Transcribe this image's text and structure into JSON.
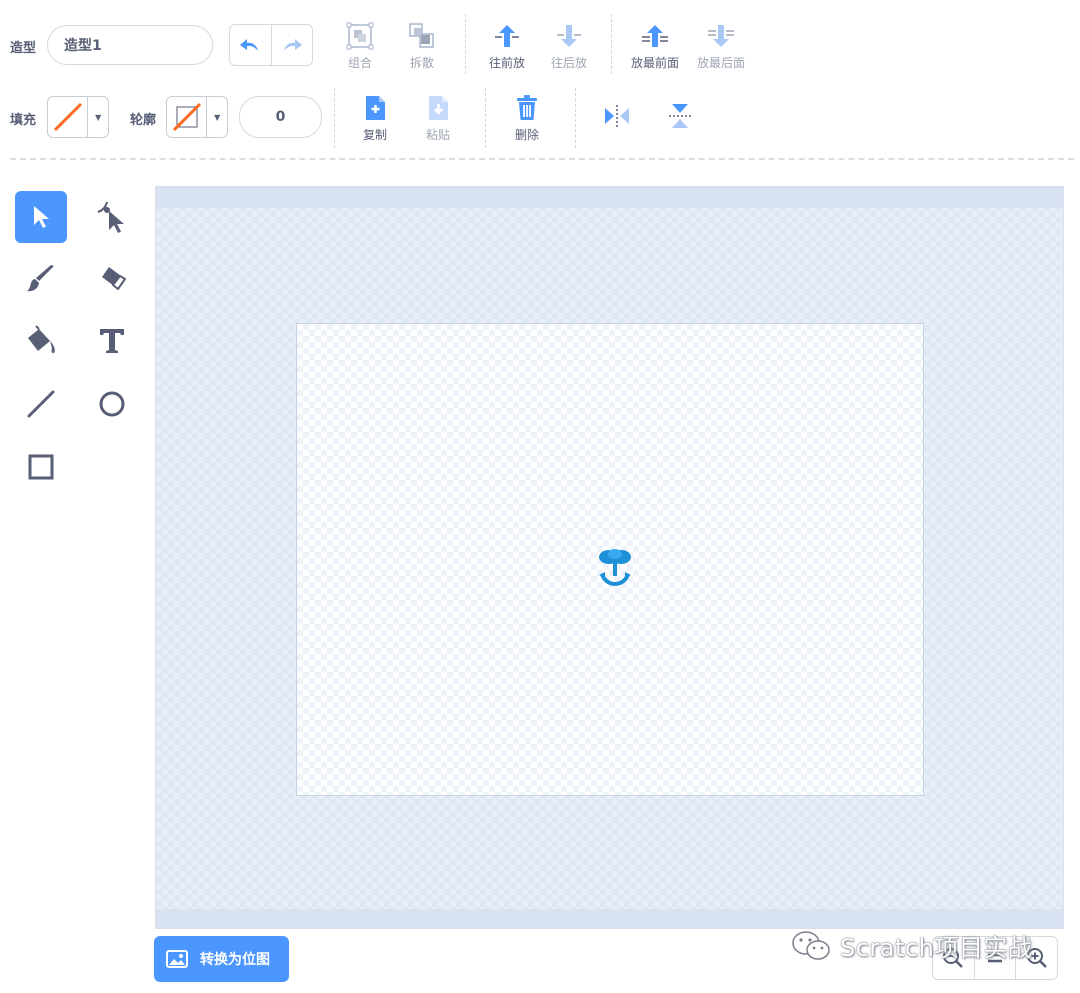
{
  "costume": {
    "label": "造型",
    "name_value": "造型1"
  },
  "toolbar_row1": {
    "group": "组合",
    "ungroup": "拆散",
    "forward": "往前放",
    "backward": "往后放",
    "front": "放最前面",
    "back": "放最后面"
  },
  "toolbar_row2": {
    "fill_label": "填充",
    "outline_label": "轮廓",
    "outline_width": "0",
    "copy": "复制",
    "paste": "粘贴",
    "delete": "删除"
  },
  "bottom": {
    "convert_label": "转换为位图"
  },
  "watermark": {
    "text": "Scratch项目实战"
  },
  "colors": {
    "accent": "#4c97ff",
    "text": "#575e75",
    "disabled": "#a0a6b5",
    "no_color_slash": "#ff6a1f",
    "sprite": "#1e90d8"
  },
  "icons": {
    "undo": "undo-icon",
    "redo": "redo-icon",
    "select": "arrow-select-icon",
    "reshape": "reshape-icon",
    "brush": "brush-icon",
    "eraser": "eraser-icon",
    "fill": "paint-bucket-icon",
    "text": "text-t-icon",
    "line": "line-icon",
    "circle": "circle-icon",
    "rect": "rectangle-icon"
  }
}
